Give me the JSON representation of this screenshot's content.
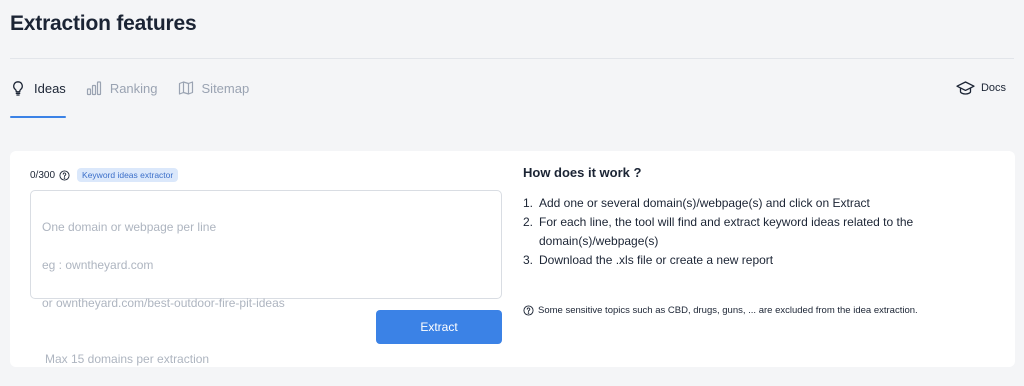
{
  "page": {
    "title": "Extraction features"
  },
  "tabs": [
    {
      "label": "Ideas",
      "icon": "lightbulb-icon",
      "active": true
    },
    {
      "label": "Ranking",
      "icon": "bar-chart-icon",
      "active": false
    },
    {
      "label": "Sitemap",
      "icon": "map-icon",
      "active": false
    }
  ],
  "docs": {
    "label": "Docs",
    "icon": "graduation-cap-icon"
  },
  "form": {
    "counter": "0/300",
    "badge": "Keyword ideas extractor",
    "placeholder": {
      "line1": "One domain or webpage per line",
      "line2": "eg : owntheyard.com",
      "line3": "or owntheyard.com/best-outdoor-fire-pit-ideas",
      "line4": "Max 15 domains per extraction"
    },
    "value": "",
    "submit_label": "Extract"
  },
  "how": {
    "title": "How does it work ?",
    "steps": [
      {
        "num": "1.",
        "text": "Add one or several domain(s)/webpage(s) and click on Extract"
      },
      {
        "num": "2.",
        "text": "For each line, the tool will find and extract keyword ideas related to the domain(s)/webpage(s)"
      },
      {
        "num": "3.",
        "text": "Download the .xls file or create a new report"
      }
    ],
    "note": "Some sensitive topics such as CBD, drugs, guns, ... are excluded from the idea extraction."
  },
  "colors": {
    "accent": "#3b82e6",
    "text": "#1b2434",
    "muted": "#9aa3b2",
    "badge_bg": "#dbe8fb"
  }
}
